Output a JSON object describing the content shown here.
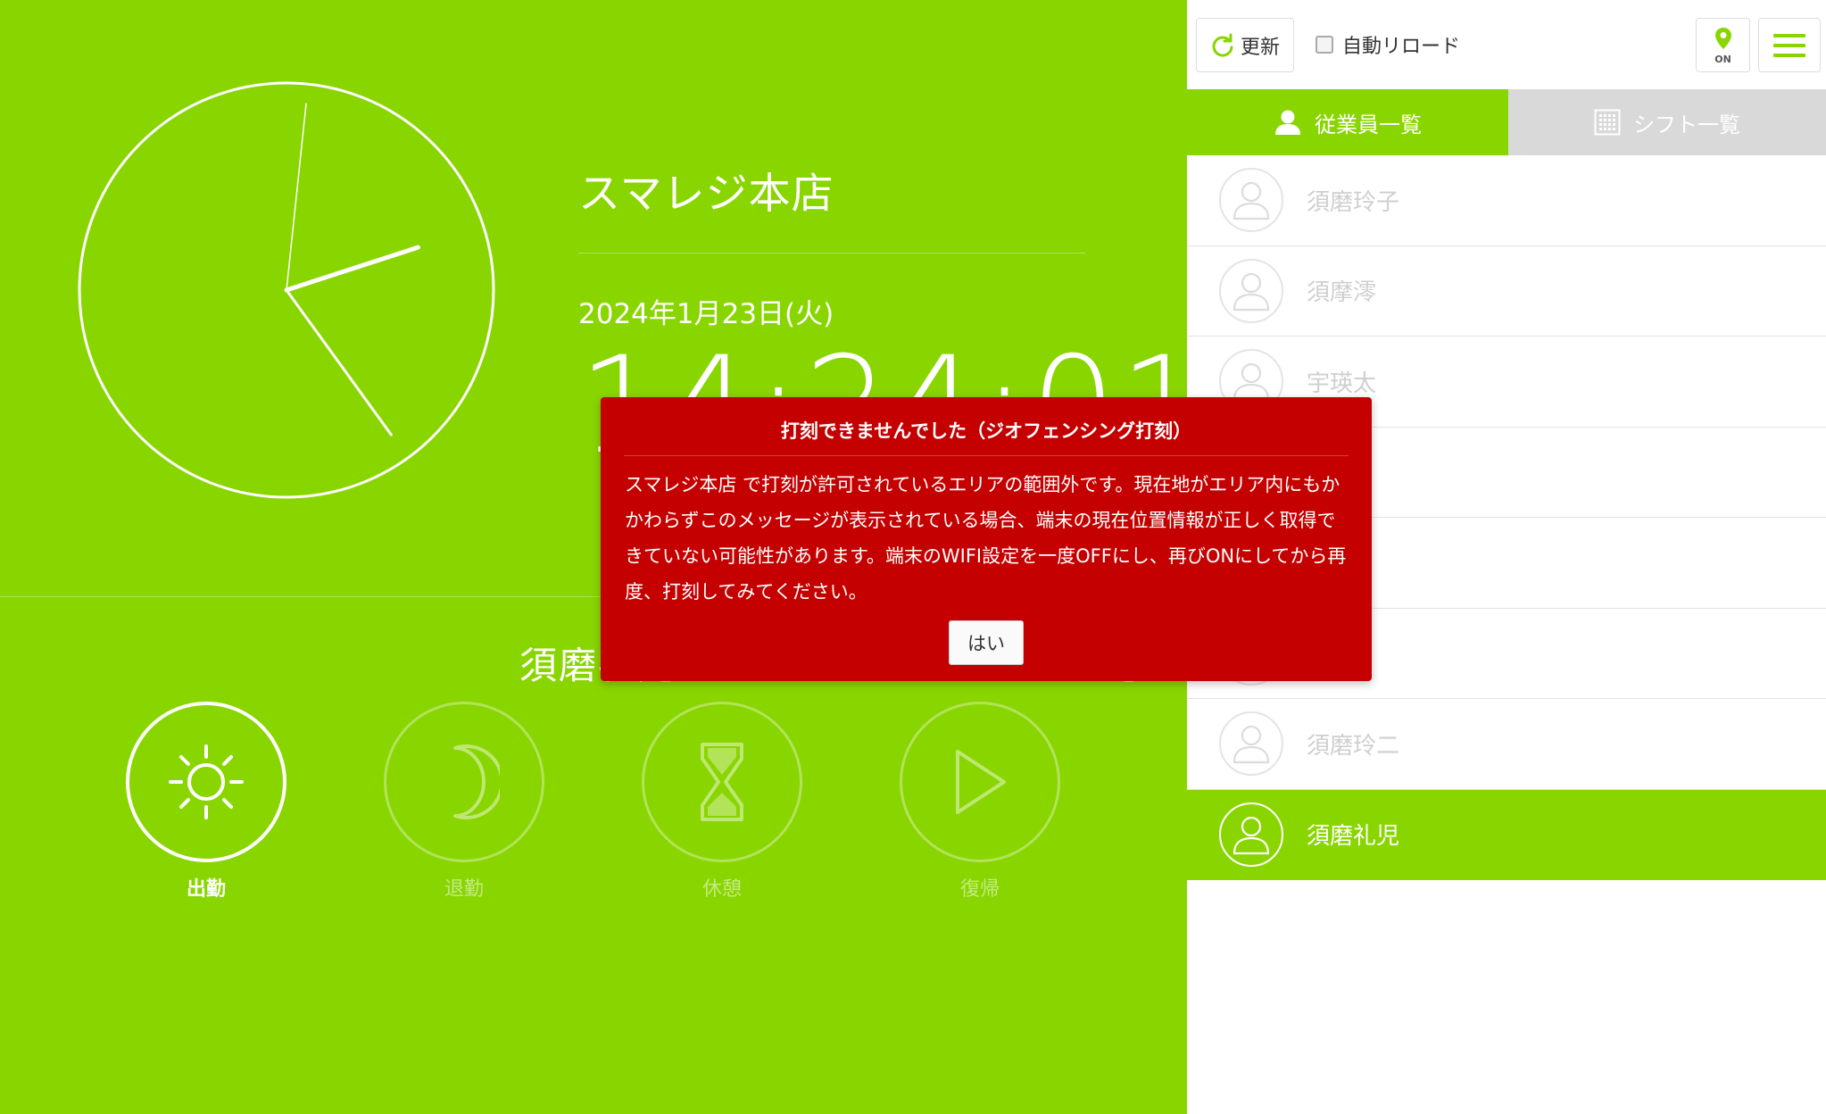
{
  "clock": {
    "hour": 14,
    "minute": 24,
    "second": 1
  },
  "store": {
    "name": "スマレジ本店"
  },
  "datetime": {
    "date": "2024年1月23日(火)",
    "time": "14:24:01"
  },
  "employee": {
    "name_partial": "須磨礼児"
  },
  "actions": {
    "clock_in": "出勤",
    "clock_out": "退勤",
    "break": "休憩",
    "return": "復帰"
  },
  "toolbar": {
    "refresh_label": "更新",
    "autoreload_label": "自動リロード",
    "geo_status": "ON"
  },
  "tabs": {
    "employees": "従業員一覧",
    "shifts": "シフト一覧"
  },
  "employees": [
    {
      "name": "須磨玲子"
    },
    {
      "name": "須摩澪"
    },
    {
      "name": "宇瑛太"
    },
    {
      "name": ""
    },
    {
      "name": ""
    },
    {
      "name": ""
    },
    {
      "name": "須磨玲二"
    },
    {
      "name": "須磨礼児"
    }
  ],
  "modal": {
    "title": "打刻できませんでした（ジオフェンシング打刻）",
    "body": "スマレジ本店 で打刻が許可されているエリアの範囲外です。現在地がエリア内にもかかわらずこのメッセージが表示されている場合、端末の現在位置情報が正しく取得できていない可能性があります。端末のWIFI設定を一度OFFにし、再びONにしてから再度、打刻してみてください。",
    "ok_label": "はい"
  },
  "colors": {
    "brand_green": "#89d500",
    "alert_red": "#c40000",
    "inactive_tab": "#d9d9d9"
  }
}
